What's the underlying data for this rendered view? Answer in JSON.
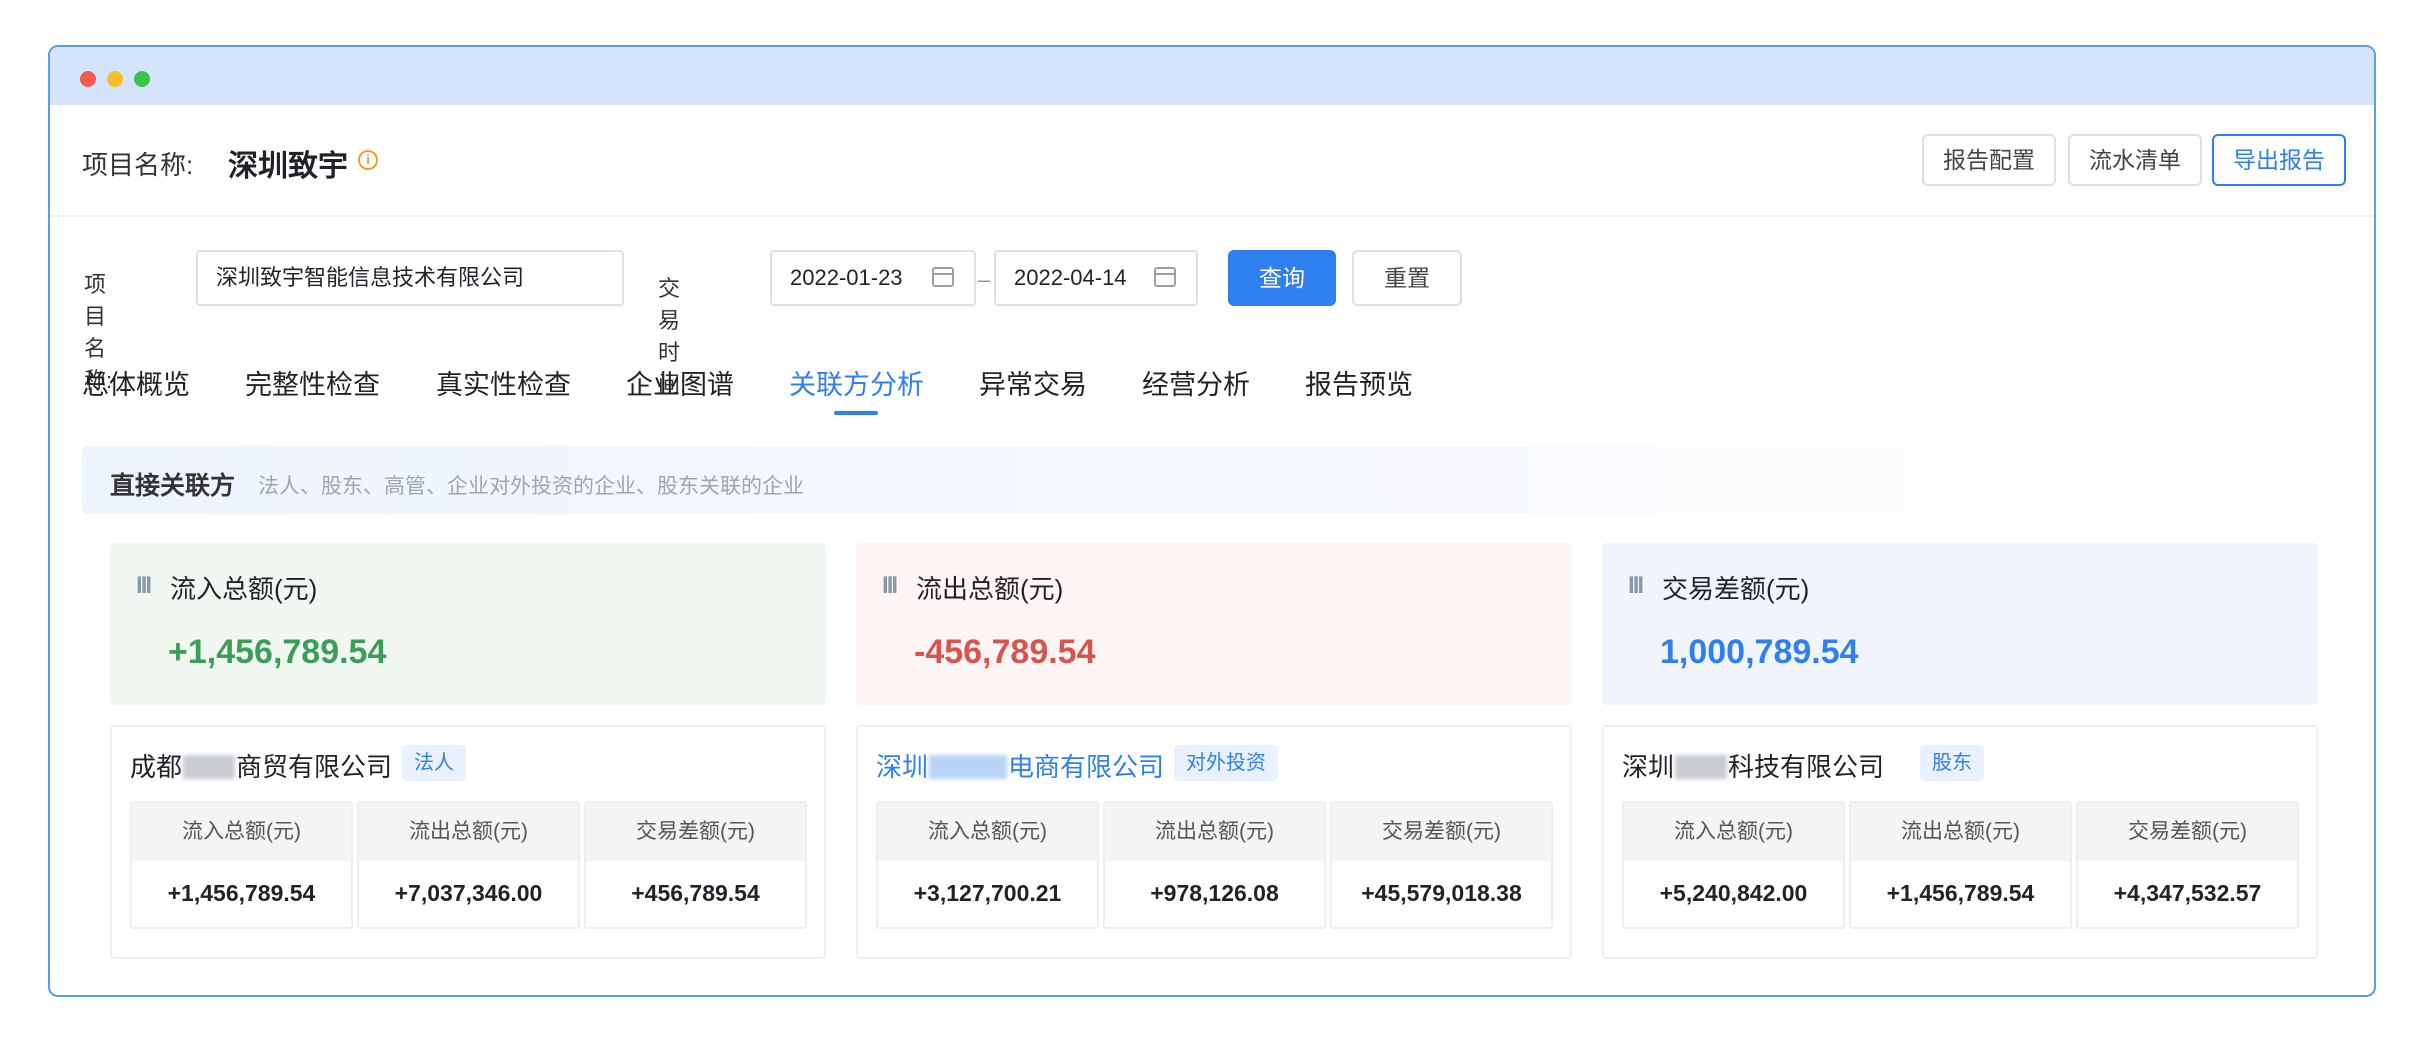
{
  "header": {
    "project_label": "项目名称:",
    "project_name": "深圳致宇",
    "buttons": [
      "报告配置",
      "流水清单",
      "导出报告"
    ]
  },
  "filters": {
    "name_label": "项目名称:",
    "name_value": "深圳致宇智能信息技术有限公司",
    "time_label": "交易时间:",
    "start_date": "2022-01-23",
    "separator": "–",
    "end_date": "2022-04-14",
    "query_label": "查询",
    "reset_label": "重置"
  },
  "tabs": [
    "总体概览",
    "完整性检查",
    "真实性检查",
    "企业图谱",
    "关联方分析",
    "异常交易",
    "经营分析",
    "报告预览"
  ],
  "active_tab": "关联方分析",
  "section": {
    "title": "直接关联方",
    "desc": "法人、股东、高管、企业对外投资的企业、股东关联的企业"
  },
  "summaries": [
    {
      "label": "流入总额(元)",
      "value": "+1,456,789.54"
    },
    {
      "label": "流出总额(元)",
      "value": "-456,789.54"
    },
    {
      "label": "交易差额(元)",
      "value": "1,000,789.54"
    }
  ],
  "cards": [
    {
      "name_prefix": "成都",
      "name_suffix": "商贸有限公司",
      "tag": "法人",
      "columns": [
        {
          "head": "流入总额(元)",
          "value": "+1,456,789.54"
        },
        {
          "head": "流出总额(元)",
          "value": "+7,037,346.00"
        },
        {
          "head": "交易差额(元)",
          "value": "+456,789.54"
        }
      ]
    },
    {
      "name_prefix": "深圳",
      "name_suffix": "电商有限公司",
      "tag": "对外投资",
      "columns": [
        {
          "head": "流入总额(元)",
          "value": "+3,127,700.21"
        },
        {
          "head": "流出总额(元)",
          "value": "+978,126.08"
        },
        {
          "head": "交易差额(元)",
          "value": "+45,579,018.38"
        }
      ]
    },
    {
      "name_prefix": "深圳",
      "name_suffix": "科技有限公司",
      "tag": "股东",
      "columns": [
        {
          "head": "流入总额(元)",
          "value": "+5,240,842.00"
        },
        {
          "head": "流出总额(元)",
          "value": "+1,456,789.54"
        },
        {
          "head": "交易差额(元)",
          "value": "+4,347,532.57"
        }
      ]
    }
  ]
}
